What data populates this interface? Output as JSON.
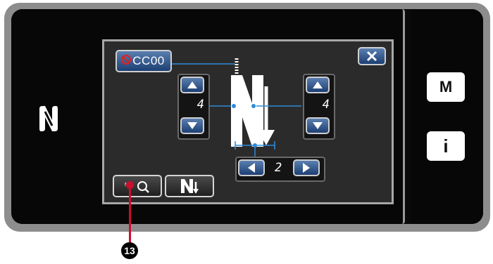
{
  "pattern_button": {
    "label": "CC00"
  },
  "close_button": {
    "icon": "close-icon"
  },
  "left_value": {
    "value": "4"
  },
  "right_value": {
    "value": "4"
  },
  "bottom_value": {
    "value": "2"
  },
  "side": {
    "m_label": "M",
    "info_label": "i"
  },
  "callout": {
    "label": "13"
  },
  "colors": {
    "accent_blue": "#1d3f73",
    "line_blue": "#2e8bd9",
    "callout_red": "#c8102e"
  }
}
